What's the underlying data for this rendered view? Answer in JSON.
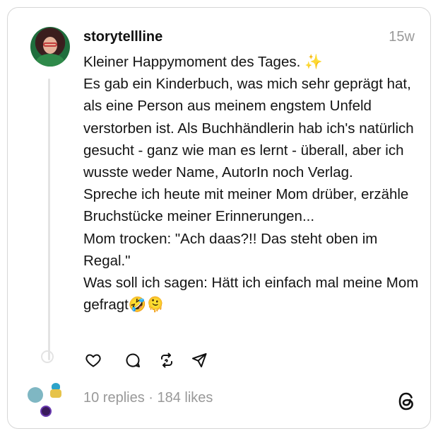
{
  "post": {
    "username": "storytellline",
    "timestamp": "15w",
    "lines": [
      "Kleiner Happymoment des Tages. ✨",
      "Es gab ein Kinderbuch, was mich sehr geprägt hat, als eine Person aus meinem engstem Unfeld verstorben ist. Als Buchhändlerin hab ich's natürlich gesucht - ganz wie man es lernt - überall, aber ich wusste weder Name, AutorIn noch Verlag.",
      "Spreche ich heute mit meiner Mom drüber, erzähle Bruchstücke meiner Erinnerungen...",
      "Mom trocken: \"Ach daas?!! Das steht oben im Regal.\"",
      "Was soll ich sagen: Hätt ich einfach mal meine Mom gefragt🤣🫠"
    ]
  },
  "actions": {
    "like_icon": "heart-icon",
    "comment_icon": "comment-icon",
    "repost_icon": "repost-icon",
    "share_icon": "share-icon"
  },
  "footer": {
    "stats": "10 replies · 184 likes",
    "logo_icon": "threads-logo-icon"
  },
  "colors": {
    "text": "#141414",
    "muted": "#999999",
    "border": "#d6d6d6",
    "thread_line": "#e3e3e3"
  }
}
